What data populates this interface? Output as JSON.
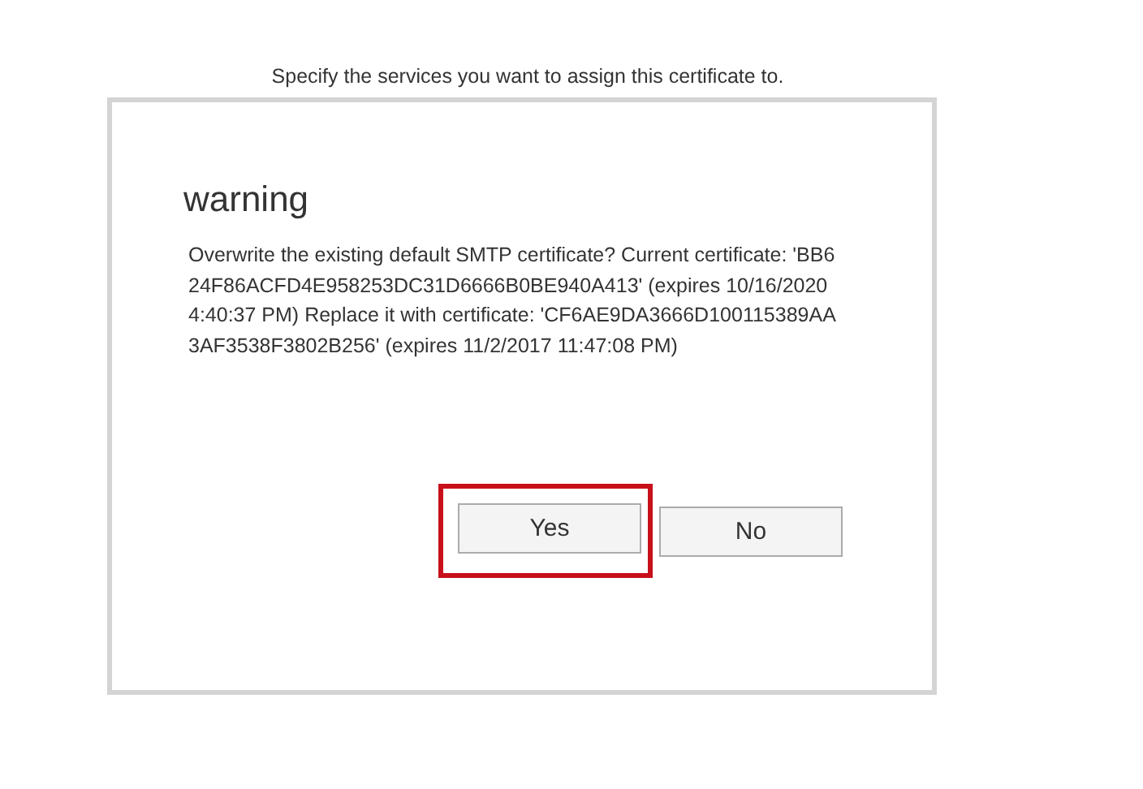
{
  "instruction": "Specify the services you want to assign this certificate to.",
  "dialog": {
    "title": "warning",
    "message": "Overwrite the existing default SMTP certificate? Current certificate: 'BB624F86ACFD4E958253DC31D6666B0BE940A413' (expires 10/16/2020 4:40:37 PM) Replace it with certificate: 'CF6AE9DA3666D100115389AA3AF3538F3802B256' (expires 11/2/2017 11:47:08 PM)",
    "buttons": [
      {
        "label": "Yes",
        "highlighted": true
      },
      {
        "label": "No",
        "highlighted": false
      }
    ]
  }
}
